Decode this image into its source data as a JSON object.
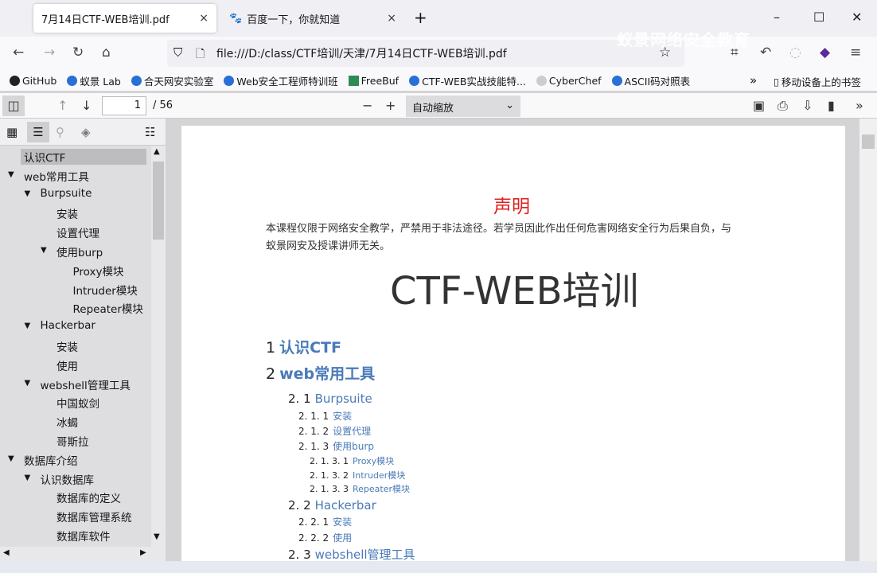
{
  "tabs": [
    {
      "label": "7月14日CTF-WEB培训.pdf",
      "close": "×"
    },
    {
      "label": "百度一下，你就知道",
      "close": "×"
    }
  ],
  "new_tab": "+",
  "window_controls": {
    "minimize": "–",
    "maximize": "☐",
    "close": "✕"
  },
  "watermark": "蚁景网络安全教育",
  "url": "file:///D:/class/CTF培训/天津/7月14日CTF-WEB培训.pdf",
  "bookmarks": [
    "GitHub",
    "蚁景 Lab",
    "合天网安实验室",
    "Web安全工程师特训班",
    "FreeBuf",
    "CTF-WEB实战技能特...",
    "CyberChef",
    "ASCII码对照表"
  ],
  "bookmarks_overflow": "»",
  "mobile_bookmarks": "移动设备上的书签",
  "pdf_toolbar": {
    "page": "1",
    "total": "/ 56",
    "zoom": "自动缩放"
  },
  "outline": [
    {
      "label": "认识CTF",
      "level": 0,
      "twisty": ""
    },
    {
      "label": "web常用工具",
      "level": 0,
      "twisty": "▼"
    },
    {
      "label": "Burpsuite",
      "level": 1,
      "twisty": "▼"
    },
    {
      "label": "安装",
      "level": 2,
      "twisty": ""
    },
    {
      "label": "设置代理",
      "level": 2,
      "twisty": ""
    },
    {
      "label": "使用burp",
      "level": 2,
      "twisty": "▼"
    },
    {
      "label": "Proxy模块",
      "level": 3,
      "twisty": ""
    },
    {
      "label": "Intruder模块",
      "level": 3,
      "twisty": ""
    },
    {
      "label": "Repeater模块",
      "level": 3,
      "twisty": ""
    },
    {
      "label": "Hackerbar",
      "level": 1,
      "twisty": "▼"
    },
    {
      "label": "安装",
      "level": 2,
      "twisty": ""
    },
    {
      "label": "使用",
      "level": 2,
      "twisty": ""
    },
    {
      "label": "webshell管理工具",
      "level": 1,
      "twisty": "▼"
    },
    {
      "label": "中国蚁剑",
      "level": 2,
      "twisty": ""
    },
    {
      "label": "冰蝎",
      "level": 2,
      "twisty": ""
    },
    {
      "label": "哥斯拉",
      "level": 2,
      "twisty": ""
    },
    {
      "label": "数据库介绍",
      "level": 0,
      "twisty": "▼"
    },
    {
      "label": "认识数据库",
      "level": 1,
      "twisty": "▼"
    },
    {
      "label": "数据库的定义",
      "level": 2,
      "twisty": ""
    },
    {
      "label": "数据库管理系统",
      "level": 2,
      "twisty": ""
    },
    {
      "label": "数据库软件",
      "level": 2,
      "twisty": ""
    }
  ],
  "document": {
    "notice_title": "声明",
    "notice_text1": "本课程仅限于网络安全教学，严禁用于非法途径。若学员因此作出任何危害网络安全行为后果自负，与",
    "notice_text2": "蚁景网安及授课讲师无关。",
    "title": "CTF-WEB培训",
    "toc": [
      {
        "num": "1",
        "label": "认识CTF",
        "level": 0
      },
      {
        "num": "2",
        "label": "web常用工具",
        "level": 0
      },
      {
        "num": "2. 1",
        "label": "Burpsuite",
        "level": 1
      },
      {
        "num": "2. 1. 1",
        "label": "安装",
        "level": 2
      },
      {
        "num": "2. 1. 2",
        "label": "设置代理",
        "level": 2
      },
      {
        "num": "2. 1. 3",
        "label": "使用burp",
        "level": 2
      },
      {
        "num": "2. 1. 3. 1",
        "label": "Proxy模块",
        "level": 3
      },
      {
        "num": "2. 1. 3. 2",
        "label": "Intruder模块",
        "level": 3
      },
      {
        "num": "2. 1. 3. 3",
        "label": "Repeater模块",
        "level": 3
      },
      {
        "num": "2. 2",
        "label": "Hackerbar",
        "level": 1
      },
      {
        "num": "2. 2. 1",
        "label": "安装",
        "level": 2
      },
      {
        "num": "2. 2. 2",
        "label": "使用",
        "level": 2
      },
      {
        "num": "2. 3",
        "label": "webshell管理工具",
        "level": 1
      }
    ]
  }
}
